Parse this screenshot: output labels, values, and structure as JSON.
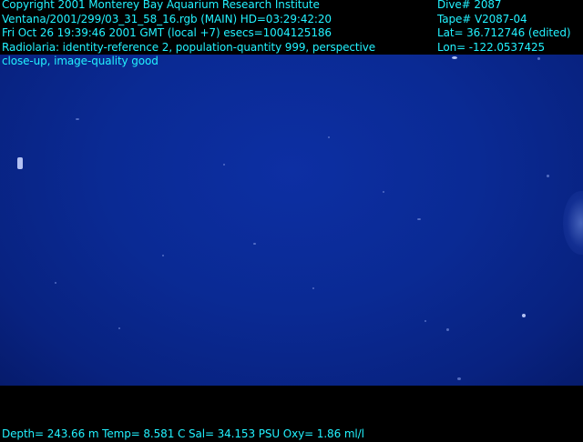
{
  "overlay": {
    "left_lines": [
      "Copyright 2001 Monterey Bay Aquarium Research Institute",
      "Ventana/2001/299/03_31_58_16.rgb (MAIN)  HD=03:29:42:20",
      "Fri Oct 26 19:39:46 2001 GMT (local +7)  esecs=1004125186",
      "Radiolaria: identity-reference 2, population-quantity 999, perspective",
      "close-up, image-quality good"
    ],
    "right_lines": [
      "Dive# 2087",
      "Tape# V2087-04",
      "Lat= 36.712746 (edited)",
      "Lon= -122.0537425"
    ],
    "bottom_line": "Depth= 243.66 m  Temp= 8.581 C  Sal= 34.153 PSU  Oxy= 1.86 ml/l"
  },
  "colors": {
    "overlay_text": "#22f2ff",
    "water": "#0a2a94",
    "frame": "#000000"
  }
}
